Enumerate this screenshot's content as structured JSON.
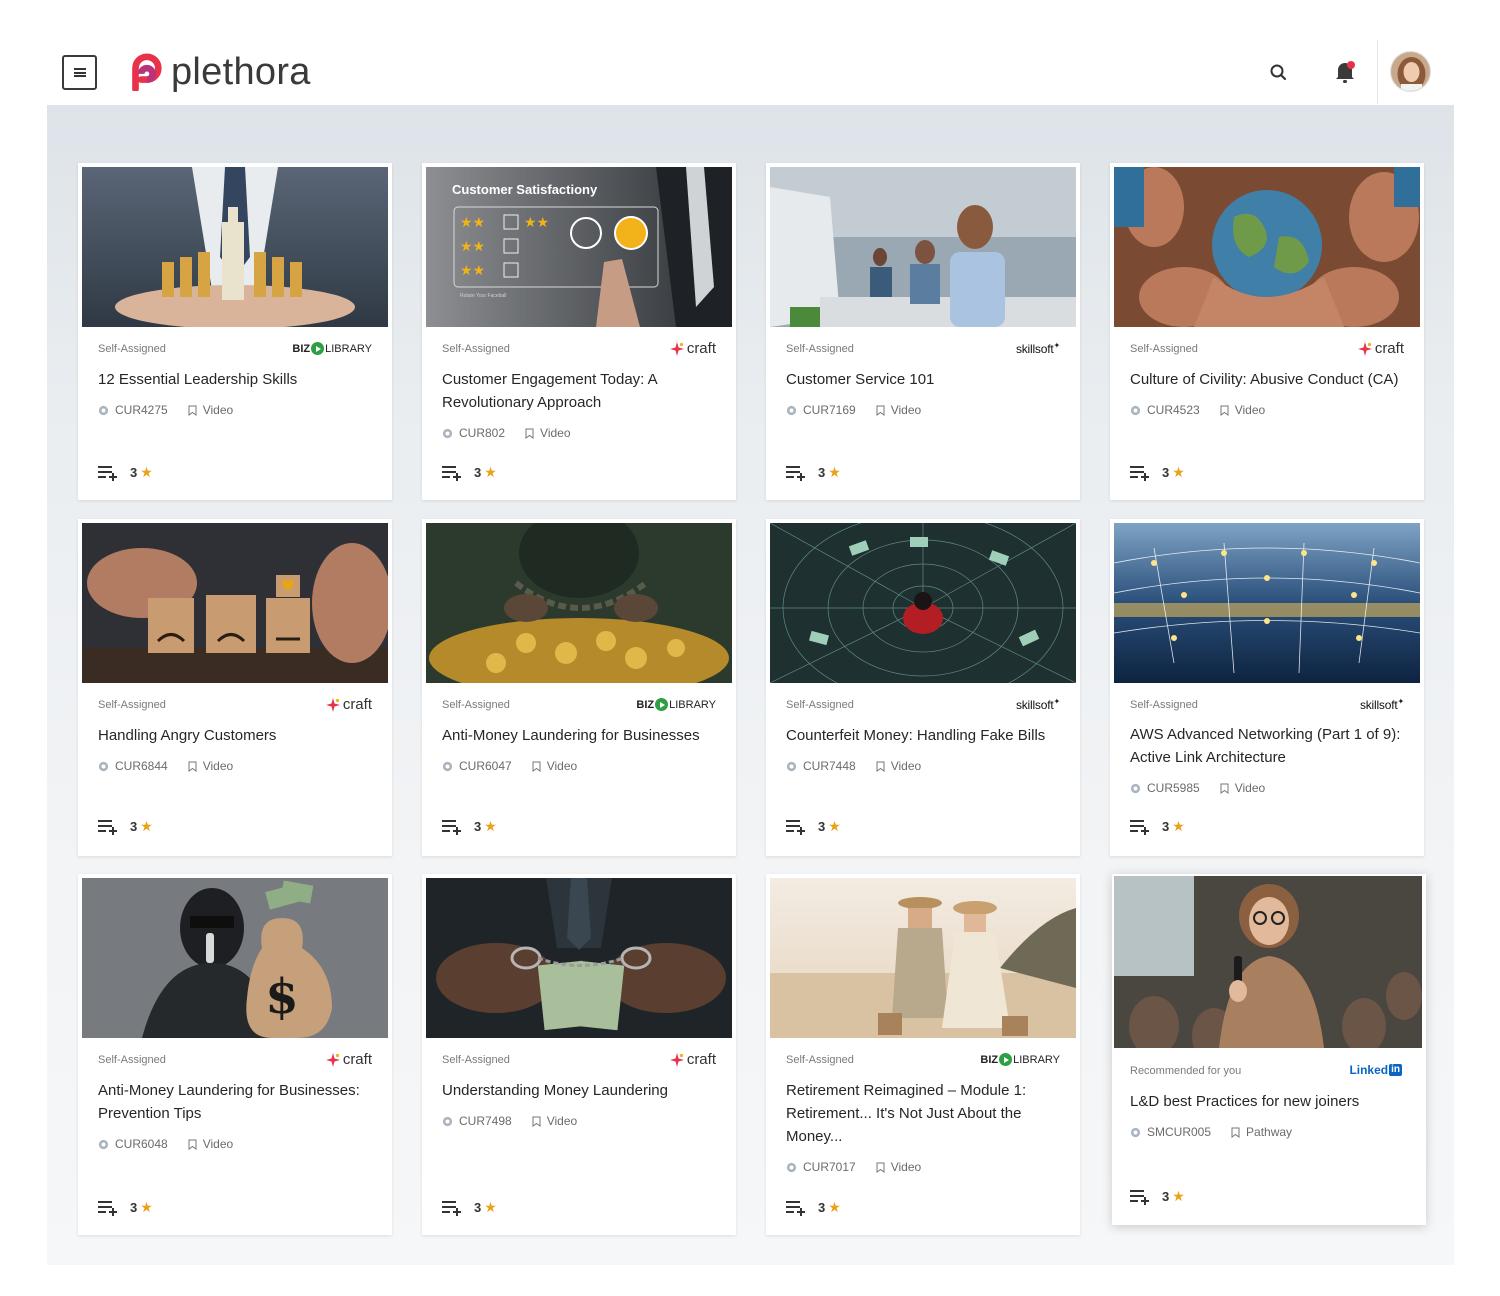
{
  "app": {
    "name": "plethora"
  },
  "header": {
    "menu": "menu",
    "search": "search",
    "notifications": "notifications",
    "profile": "profile"
  },
  "cards": [
    {
      "assign": "Self-Assigned",
      "provider": "biz",
      "provider_text": [
        "BIZ",
        "LIBRARY"
      ],
      "title": "12 Essential Leadership Skills",
      "code": "CUR4275",
      "type": "Video",
      "rating": "3"
    },
    {
      "assign": "Self-Assigned",
      "provider": "craft",
      "provider_text": [
        "craft"
      ],
      "title": "Customer Engagement Today: A Revolutionary Approach",
      "code": "CUR802",
      "type": "Video",
      "rating": "3",
      "thumb_text": [
        "Customer Satisfactiony",
        "Rotate Your Faceball"
      ]
    },
    {
      "assign": "Self-Assigned",
      "provider": "skillsoft",
      "provider_text": [
        "skillsoft"
      ],
      "title": "Customer Service 101",
      "code": "CUR7169",
      "type": "Video",
      "rating": "3"
    },
    {
      "assign": "Self-Assigned",
      "provider": "craft",
      "provider_text": [
        "craft"
      ],
      "title": "Culture of Civility: Abusive Conduct (CA)",
      "code": "CUR4523",
      "type": "Video",
      "rating": "3"
    },
    {
      "assign": "Self-Assigned",
      "provider": "craft",
      "provider_text": [
        "craft"
      ],
      "title": "Handling Angry Customers",
      "code": "CUR6844",
      "type": "Video",
      "rating": "3"
    },
    {
      "assign": "Self-Assigned",
      "provider": "biz",
      "provider_text": [
        "BIZ",
        "LIBRARY"
      ],
      "title": "Anti-Money Laundering for Businesses",
      "code": "CUR6047",
      "type": "Video",
      "rating": "3"
    },
    {
      "assign": "Self-Assigned",
      "provider": "skillsoft",
      "provider_text": [
        "skillsoft"
      ],
      "title": "Counterfeit Money: Handling Fake Bills",
      "code": "CUR7448",
      "type": "Video",
      "rating": "3"
    },
    {
      "assign": "Self-Assigned",
      "provider": "skillsoft",
      "provider_text": [
        "skillsoft"
      ],
      "title": "AWS Advanced Networking (Part 1 of 9): Active Link Architecture",
      "code": "CUR5985",
      "type": "Video",
      "rating": "3"
    },
    {
      "assign": "Self-Assigned",
      "provider": "craft",
      "provider_text": [
        "craft"
      ],
      "title": "Anti-Money Laundering for Businesses: Prevention Tips",
      "code": "CUR6048",
      "type": "Video",
      "rating": "3"
    },
    {
      "assign": "Self-Assigned",
      "provider": "craft",
      "provider_text": [
        "craft"
      ],
      "title": "Understanding Money Laundering",
      "code": "CUR7498",
      "type": "Video",
      "rating": "3"
    },
    {
      "assign": "Self-Assigned",
      "provider": "biz",
      "provider_text": [
        "BIZ",
        "LIBRARY"
      ],
      "title": "Retirement Reimagined – Module 1: Retirement... It's Not Just About the Money...",
      "code": "CUR7017",
      "type": "Video",
      "rating": "3"
    },
    {
      "assign": "Recommended for you",
      "provider": "linkedin",
      "provider_text": [
        "Linked",
        "in"
      ],
      "title": "L&D best Practices for new joiners",
      "code": "SMCUR005",
      "type": "Pathway",
      "rating": "3"
    }
  ],
  "colors": {
    "brand_red": "#e8324a",
    "brand_pink": "#b8337a",
    "star": "#e8a417",
    "bizlib_green": "#2ea043",
    "linkedin_blue": "#0a66c2"
  },
  "icons": {
    "code": "badge-icon",
    "type": "bookmark-icon",
    "footer": "playlist-add-icon",
    "rating": "star-icon"
  }
}
